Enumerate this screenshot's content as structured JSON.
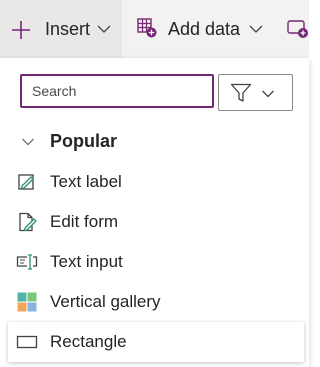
{
  "toolbar": {
    "insert_label": "Insert",
    "add_data_label": "Add data",
    "insert_icon": "plus-icon",
    "add_data_icon": "table-add-icon",
    "media_icon": "media-add-icon"
  },
  "flyout": {
    "search": {
      "placeholder": "Search",
      "value": ""
    },
    "filter_icon": "filter-icon",
    "section": {
      "label": "Popular",
      "expanded": true
    },
    "items": [
      {
        "label": "Text label",
        "icon": "text-label-icon"
      },
      {
        "label": "Edit form",
        "icon": "edit-form-icon"
      },
      {
        "label": "Text input",
        "icon": "text-input-icon"
      },
      {
        "label": "Vertical gallery",
        "icon": "gallery-icon"
      },
      {
        "label": "Rectangle",
        "icon": "rectangle-icon",
        "hovered": true
      }
    ]
  },
  "colors": {
    "accent": "#742774",
    "toolbar_bg": "#f3f2f1",
    "insert_bg": "#e9e8e7",
    "text": "#242424",
    "gallery_teal": "#4fb3a9",
    "gallery_green": "#7bc57b",
    "gallery_orange": "#f2a65a",
    "gallery_blue": "#8ab4e0"
  }
}
